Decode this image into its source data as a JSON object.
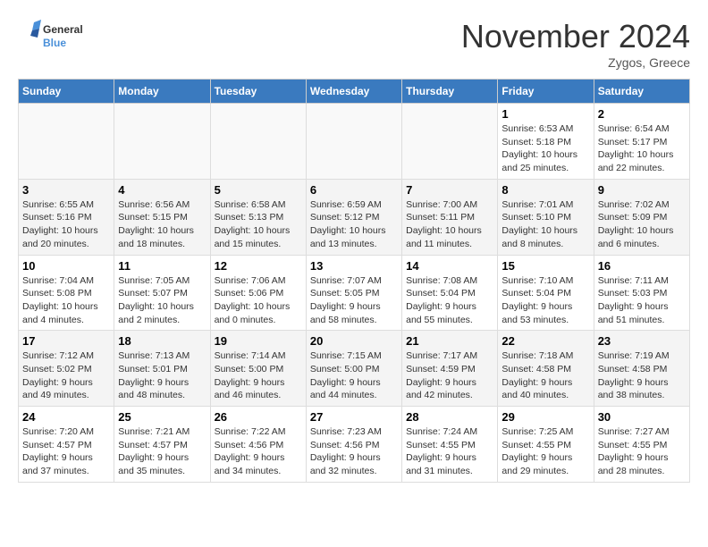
{
  "logo": {
    "line1": "General",
    "line2": "Blue"
  },
  "title": "November 2024",
  "location": "Zygos, Greece",
  "days_of_week": [
    "Sunday",
    "Monday",
    "Tuesday",
    "Wednesday",
    "Thursday",
    "Friday",
    "Saturday"
  ],
  "weeks": [
    [
      {
        "day": "",
        "empty": true
      },
      {
        "day": "",
        "empty": true
      },
      {
        "day": "",
        "empty": true
      },
      {
        "day": "",
        "empty": true
      },
      {
        "day": "",
        "empty": true
      },
      {
        "day": "1",
        "sunrise": "Sunrise: 6:53 AM",
        "sunset": "Sunset: 5:18 PM",
        "daylight": "Daylight: 10 hours and 25 minutes."
      },
      {
        "day": "2",
        "sunrise": "Sunrise: 6:54 AM",
        "sunset": "Sunset: 5:17 PM",
        "daylight": "Daylight: 10 hours and 22 minutes."
      }
    ],
    [
      {
        "day": "3",
        "sunrise": "Sunrise: 6:55 AM",
        "sunset": "Sunset: 5:16 PM",
        "daylight": "Daylight: 10 hours and 20 minutes."
      },
      {
        "day": "4",
        "sunrise": "Sunrise: 6:56 AM",
        "sunset": "Sunset: 5:15 PM",
        "daylight": "Daylight: 10 hours and 18 minutes."
      },
      {
        "day": "5",
        "sunrise": "Sunrise: 6:58 AM",
        "sunset": "Sunset: 5:13 PM",
        "daylight": "Daylight: 10 hours and 15 minutes."
      },
      {
        "day": "6",
        "sunrise": "Sunrise: 6:59 AM",
        "sunset": "Sunset: 5:12 PM",
        "daylight": "Daylight: 10 hours and 13 minutes."
      },
      {
        "day": "7",
        "sunrise": "Sunrise: 7:00 AM",
        "sunset": "Sunset: 5:11 PM",
        "daylight": "Daylight: 10 hours and 11 minutes."
      },
      {
        "day": "8",
        "sunrise": "Sunrise: 7:01 AM",
        "sunset": "Sunset: 5:10 PM",
        "daylight": "Daylight: 10 hours and 8 minutes."
      },
      {
        "day": "9",
        "sunrise": "Sunrise: 7:02 AM",
        "sunset": "Sunset: 5:09 PM",
        "daylight": "Daylight: 10 hours and 6 minutes."
      }
    ],
    [
      {
        "day": "10",
        "sunrise": "Sunrise: 7:04 AM",
        "sunset": "Sunset: 5:08 PM",
        "daylight": "Daylight: 10 hours and 4 minutes."
      },
      {
        "day": "11",
        "sunrise": "Sunrise: 7:05 AM",
        "sunset": "Sunset: 5:07 PM",
        "daylight": "Daylight: 10 hours and 2 minutes."
      },
      {
        "day": "12",
        "sunrise": "Sunrise: 7:06 AM",
        "sunset": "Sunset: 5:06 PM",
        "daylight": "Daylight: 10 hours and 0 minutes."
      },
      {
        "day": "13",
        "sunrise": "Sunrise: 7:07 AM",
        "sunset": "Sunset: 5:05 PM",
        "daylight": "Daylight: 9 hours and 58 minutes."
      },
      {
        "day": "14",
        "sunrise": "Sunrise: 7:08 AM",
        "sunset": "Sunset: 5:04 PM",
        "daylight": "Daylight: 9 hours and 55 minutes."
      },
      {
        "day": "15",
        "sunrise": "Sunrise: 7:10 AM",
        "sunset": "Sunset: 5:04 PM",
        "daylight": "Daylight: 9 hours and 53 minutes."
      },
      {
        "day": "16",
        "sunrise": "Sunrise: 7:11 AM",
        "sunset": "Sunset: 5:03 PM",
        "daylight": "Daylight: 9 hours and 51 minutes."
      }
    ],
    [
      {
        "day": "17",
        "sunrise": "Sunrise: 7:12 AM",
        "sunset": "Sunset: 5:02 PM",
        "daylight": "Daylight: 9 hours and 49 minutes."
      },
      {
        "day": "18",
        "sunrise": "Sunrise: 7:13 AM",
        "sunset": "Sunset: 5:01 PM",
        "daylight": "Daylight: 9 hours and 48 minutes."
      },
      {
        "day": "19",
        "sunrise": "Sunrise: 7:14 AM",
        "sunset": "Sunset: 5:00 PM",
        "daylight": "Daylight: 9 hours and 46 minutes."
      },
      {
        "day": "20",
        "sunrise": "Sunrise: 7:15 AM",
        "sunset": "Sunset: 5:00 PM",
        "daylight": "Daylight: 9 hours and 44 minutes."
      },
      {
        "day": "21",
        "sunrise": "Sunrise: 7:17 AM",
        "sunset": "Sunset: 4:59 PM",
        "daylight": "Daylight: 9 hours and 42 minutes."
      },
      {
        "day": "22",
        "sunrise": "Sunrise: 7:18 AM",
        "sunset": "Sunset: 4:58 PM",
        "daylight": "Daylight: 9 hours and 40 minutes."
      },
      {
        "day": "23",
        "sunrise": "Sunrise: 7:19 AM",
        "sunset": "Sunset: 4:58 PM",
        "daylight": "Daylight: 9 hours and 38 minutes."
      }
    ],
    [
      {
        "day": "24",
        "sunrise": "Sunrise: 7:20 AM",
        "sunset": "Sunset: 4:57 PM",
        "daylight": "Daylight: 9 hours and 37 minutes."
      },
      {
        "day": "25",
        "sunrise": "Sunrise: 7:21 AM",
        "sunset": "Sunset: 4:57 PM",
        "daylight": "Daylight: 9 hours and 35 minutes."
      },
      {
        "day": "26",
        "sunrise": "Sunrise: 7:22 AM",
        "sunset": "Sunset: 4:56 PM",
        "daylight": "Daylight: 9 hours and 34 minutes."
      },
      {
        "day": "27",
        "sunrise": "Sunrise: 7:23 AM",
        "sunset": "Sunset: 4:56 PM",
        "daylight": "Daylight: 9 hours and 32 minutes."
      },
      {
        "day": "28",
        "sunrise": "Sunrise: 7:24 AM",
        "sunset": "Sunset: 4:55 PM",
        "daylight": "Daylight: 9 hours and 31 minutes."
      },
      {
        "day": "29",
        "sunrise": "Sunrise: 7:25 AM",
        "sunset": "Sunset: 4:55 PM",
        "daylight": "Daylight: 9 hours and 29 minutes."
      },
      {
        "day": "30",
        "sunrise": "Sunrise: 7:27 AM",
        "sunset": "Sunset: 4:55 PM",
        "daylight": "Daylight: 9 hours and 28 minutes."
      }
    ]
  ]
}
